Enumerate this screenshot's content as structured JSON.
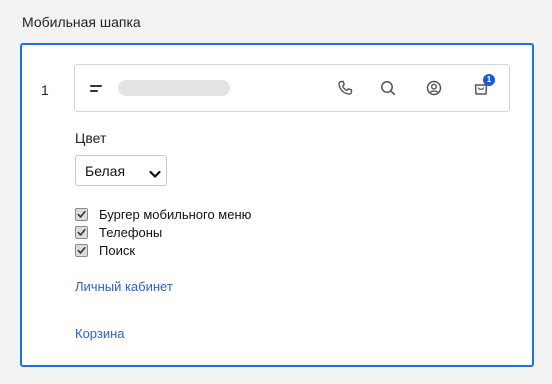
{
  "section": {
    "title": "Мобильная шапка"
  },
  "row": {
    "number": "1"
  },
  "preview": {
    "icons": [
      "burger-menu-icon",
      "phone-icon",
      "search-icon",
      "user-circle-icon",
      "cart-icon"
    ],
    "cart_badge": "1",
    "accent_color": "#1a5ad6"
  },
  "color": {
    "label": "Цвет",
    "selected": "Белая"
  },
  "checkboxes": [
    {
      "label": "Бургер мобильного меню",
      "checked": true
    },
    {
      "label": "Телефоны",
      "checked": true
    },
    {
      "label": "Поиск",
      "checked": true
    }
  ],
  "links": {
    "account": "Личный кабинет",
    "cart": "Корзина"
  },
  "colors": {
    "panel_border": "#1a73e8",
    "link": "#2f5fd0"
  }
}
